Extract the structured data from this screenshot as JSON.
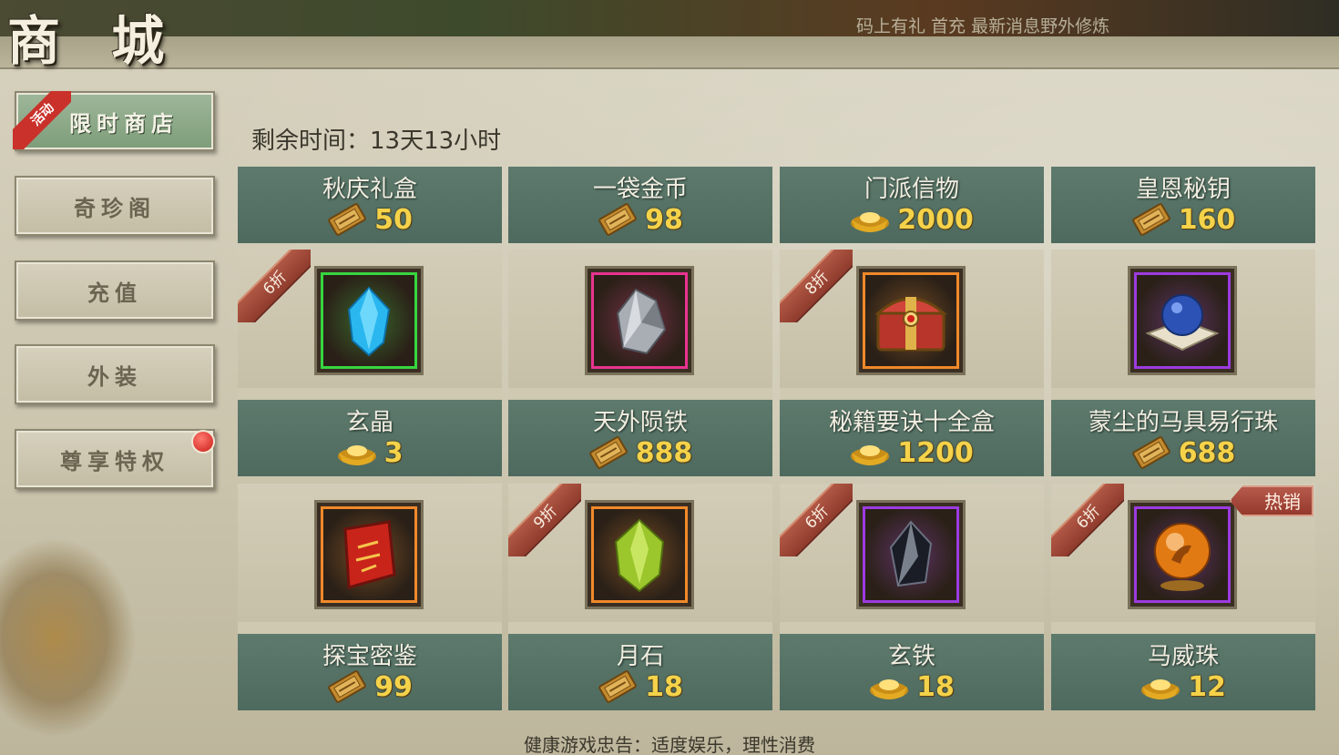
{
  "header": {
    "title": "商 城",
    "ticker": "码上有礼    首充    最新消息野外修炼"
  },
  "sidebar": {
    "badge": "活动",
    "items": [
      {
        "label": "限时商店",
        "active": true
      },
      {
        "label": "奇珍阁",
        "active": false
      },
      {
        "label": "充值",
        "active": false
      },
      {
        "label": "外装",
        "active": false
      },
      {
        "label": "尊享特权",
        "active": false,
        "notify": true
      }
    ]
  },
  "shop": {
    "remaining_label": "剩余时间：13天13小时",
    "top_row": [
      {
        "name": "秋庆礼盒",
        "currency_icon": "voucher-icon",
        "price": "50"
      },
      {
        "name": "一袋金币",
        "currency_icon": "voucher-icon",
        "price": "98"
      },
      {
        "name": "门派信物",
        "currency_icon": "gold-ingot-icon",
        "price": "2000"
      },
      {
        "name": "皇恩秘钥",
        "currency_icon": "voucher-icon",
        "price": "160"
      }
    ],
    "row2": [
      {
        "name": "玄晶",
        "currency_icon": "gold-ingot-icon",
        "price": "3",
        "discount": "6折",
        "item_icon": "blue-crystal-icon",
        "frame": "#37d640"
      },
      {
        "name": "天外陨铁",
        "currency_icon": "voucher-icon",
        "price": "888",
        "discount": "",
        "item_icon": "silver-meteorite-icon",
        "frame": "#e8348f"
      },
      {
        "name": "秘籍要诀十全盒",
        "currency_icon": "gold-ingot-icon",
        "price": "1200",
        "discount": "8折",
        "item_icon": "treasure-chest-icon",
        "frame": "#f0892a"
      },
      {
        "name": "蒙尘的马具易行珠",
        "currency_icon": "voucher-icon",
        "price": "688",
        "discount": "",
        "item_icon": "blue-orb-cushion-icon",
        "frame": "#9c3be0"
      }
    ],
    "row3": [
      {
        "name": "探宝密鉴",
        "currency_icon": "voucher-icon",
        "price": "99",
        "discount": "",
        "item_icon": "red-scroll-icon",
        "frame": "#f0892a"
      },
      {
        "name": "月石",
        "currency_icon": "voucher-icon",
        "price": "18",
        "discount": "9折",
        "item_icon": "green-gem-icon",
        "frame": "#f0892a"
      },
      {
        "name": "玄铁",
        "currency_icon": "gold-ingot-icon",
        "price": "18",
        "discount": "6折",
        "item_icon": "dark-iron-icon",
        "frame": "#9c3be0"
      },
      {
        "name": "马威珠",
        "currency_icon": "gold-ingot-icon",
        "price": "12",
        "discount": "6折",
        "hot": "热销",
        "item_icon": "horse-orb-icon",
        "frame": "#9c3be0"
      }
    ]
  },
  "footer": {
    "tip": "健康游戏忠告：适度娱乐，理性消费"
  },
  "colors": {
    "accent_green": "#5d7a6d",
    "price_gold": "#f4d24a",
    "discount_red": "#b15845"
  }
}
